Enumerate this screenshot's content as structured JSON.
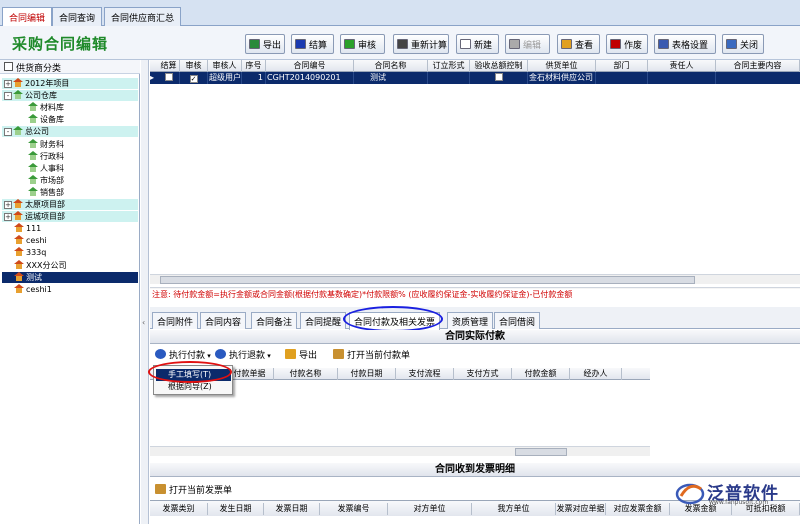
{
  "top_tabs": [
    "合同编辑",
    "合同查询",
    "合同供应商汇总"
  ],
  "page_title": "采购合同编辑",
  "toolbar": [
    {
      "label": "导出",
      "icon": "export-icon",
      "color": "#2a8a3a",
      "enabled": true
    },
    {
      "label": "结算",
      "icon": "settle-icon",
      "color": "#1a3ab0",
      "enabled": true
    },
    {
      "label": "审核",
      "icon": "approve-icon",
      "color": "#2aa02a",
      "enabled": true
    },
    {
      "label": "重新计算",
      "icon": "recalc-icon",
      "color": "#444444",
      "enabled": true
    },
    {
      "label": "新建",
      "icon": "new-icon",
      "color": "#ffffff",
      "enabled": true
    },
    {
      "label": "编辑",
      "icon": "edit-icon",
      "color": "#aaaaaa",
      "enabled": false
    },
    {
      "label": "查看",
      "icon": "view-icon",
      "color": "#e0a020",
      "enabled": true
    },
    {
      "label": "作废",
      "icon": "void-icon",
      "color": "#c00000",
      "enabled": true
    },
    {
      "label": "表格设置",
      "icon": "table-settings-icon",
      "color": "#3a5ab0",
      "enabled": true
    },
    {
      "label": "关闭",
      "icon": "close-icon",
      "color": "#3a6ac0",
      "enabled": true
    }
  ],
  "left_panel": {
    "filter_label": "供货商分类",
    "tree": [
      {
        "label": "2012年项目",
        "expand": "+",
        "icon": "house",
        "hl": true
      },
      {
        "label": "公司仓库",
        "expand": "−",
        "icon": "green",
        "hl": true
      },
      {
        "label": "材料库",
        "expand": "",
        "icon": "green",
        "hl": false
      },
      {
        "label": "设备库",
        "expand": "",
        "icon": "green",
        "hl": false
      },
      {
        "label": "总公司",
        "expand": "−",
        "icon": "green",
        "hl": true
      },
      {
        "label": "财务科",
        "expand": "",
        "icon": "green",
        "hl": false
      },
      {
        "label": "行政科",
        "expand": "",
        "icon": "green",
        "hl": false
      },
      {
        "label": "人事科",
        "expand": "",
        "icon": "green",
        "hl": false
      },
      {
        "label": "市场部",
        "expand": "",
        "icon": "green",
        "hl": false
      },
      {
        "label": "销售部",
        "expand": "",
        "icon": "green",
        "hl": false
      },
      {
        "label": "太原项目部",
        "expand": "+",
        "icon": "house",
        "hl": true
      },
      {
        "label": "运城项目部",
        "expand": "+",
        "icon": "house",
        "hl": true
      },
      {
        "label": "111",
        "expand": "",
        "icon": "house",
        "hl": false
      },
      {
        "label": "ceshi",
        "expand": "",
        "icon": "house",
        "hl": false
      },
      {
        "label": "333q",
        "expand": "",
        "icon": "house",
        "hl": false
      },
      {
        "label": "XXX分公司",
        "expand": "",
        "icon": "house",
        "hl": false
      },
      {
        "label": "测试",
        "expand": "",
        "icon": "house",
        "hl": false,
        "sel": true
      },
      {
        "label": "ceshi1",
        "expand": "",
        "icon": "house",
        "hl": false
      }
    ]
  },
  "grid": {
    "columns": [
      "结算",
      "审核",
      "审核人",
      "序号",
      "合同编号",
      "合同名称",
      "订立形式",
      "验收总额控制",
      "供货单位",
      "部门",
      "责任人",
      "合同主要内容"
    ],
    "row": {
      "approver": "超级用户",
      "seq": "1",
      "contract_no": "CGHT2014090201",
      "contract_name": "测试",
      "supplier": "金石材料供应公司"
    }
  },
  "notice": "注意: 待付款金额=执行金额或合同金额(根据付款基数确定)*付款限额% (应收履约保证金-实收履约保证金)-已付款金额",
  "sub_tabs": [
    "合同附件",
    "合同内容",
    "合同备注",
    "合同提醒",
    "合同付款及相关发票",
    "资质管理",
    "合同借阅"
  ],
  "payment": {
    "title": "合同实际付款",
    "buttons": [
      "执行付款",
      "执行退款",
      "导出",
      "打开当前付款单"
    ],
    "columns": [
      "付款单据",
      "付款名称",
      "付款日期",
      "支付流程",
      "支付方式",
      "付款金额",
      "经办人"
    ],
    "menu": [
      "手工填写(T)",
      "根据向导(Z)"
    ]
  },
  "invoice": {
    "title": "合同收到发票明细",
    "button": "打开当前发票单",
    "columns": [
      "发票类别",
      "发生日期",
      "发票日期",
      "发票编号",
      "对方单位",
      "我方单位",
      "发票对应单据",
      "对应发票金额",
      "发票金额",
      "可抵扣税额"
    ]
  },
  "logo": {
    "text": "泛普软件",
    "url": "www.fanpusoft.com"
  }
}
